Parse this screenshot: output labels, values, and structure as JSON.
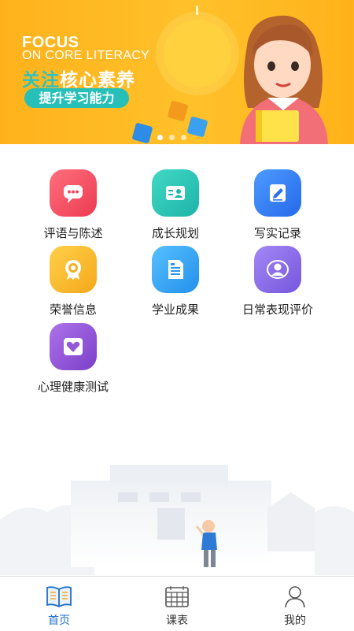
{
  "banner": {
    "title_en_1": "FOCUS",
    "title_en_2": "ON CORE LITERACY",
    "title_zh_highlight": "关注",
    "title_zh_rest": "核心素养",
    "subtitle": "提升学习能力"
  },
  "menu": [
    {
      "label": "评语与陈述",
      "icon": "comment-icon",
      "color": "#f0495d"
    },
    {
      "label": "成长规划",
      "icon": "id-card-icon",
      "color": "#27c3b4"
    },
    {
      "label": "写实记录",
      "icon": "edit-note-icon",
      "color": "#2f7ff5"
    },
    {
      "label": "荣誉信息",
      "icon": "medal-icon",
      "color": "#f8b524"
    },
    {
      "label": "学业成果",
      "icon": "document-icon",
      "color": "#2ea1f2"
    },
    {
      "label": "日常表现评价",
      "icon": "user-badge-icon",
      "color": "#8b6fe8"
    },
    {
      "label": "心理健康测试",
      "icon": "heart-pen-icon",
      "color": "#9256d9"
    }
  ],
  "tabbar": {
    "items": [
      {
        "label": "首页",
        "icon": "book-icon"
      },
      {
        "label": "课表",
        "icon": "calendar-icon"
      },
      {
        "label": "我的",
        "icon": "user-icon"
      }
    ],
    "active_color": "#1f6fc9"
  }
}
